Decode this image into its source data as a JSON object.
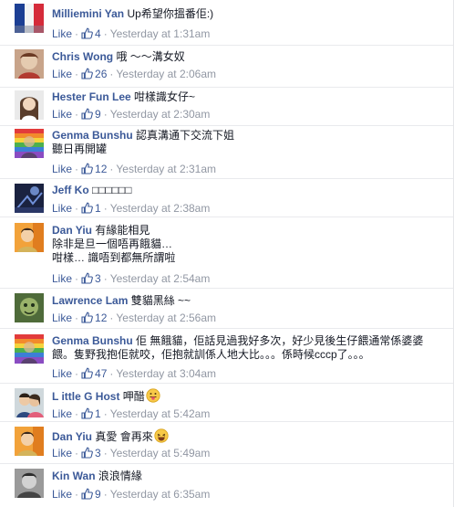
{
  "comments": [
    {
      "name": "Milliemini Yan",
      "lines": [
        "Up希望你搵番佢:)"
      ],
      "like": "Like",
      "likes": "4",
      "time": "Yesterday at 1:31am",
      "avatar": "flag"
    },
    {
      "name": "Chris Wong",
      "lines": [
        "哦 ～～溝女奴"
      ],
      "like": "Like",
      "likes": "26",
      "time": "Yesterday at 2:06am",
      "avatar": "red-portrait"
    },
    {
      "name": "Hester Fun Lee",
      "lines": [
        "咁樣識女仔~"
      ],
      "like": "Like",
      "likes": "9",
      "time": "Yesterday at 2:30am",
      "avatar": "woman-portrait"
    },
    {
      "name": "Genma Bunshu",
      "lines": [
        "認真溝通下交流下姐",
        "聽日再開罐"
      ],
      "like": "Like",
      "likes": "12",
      "time": "Yesterday at 2:31am",
      "avatar": "rainbow"
    },
    {
      "name": "Jeff Ko",
      "lines": [
        "□□□□□□"
      ],
      "like": "Like",
      "likes": "1",
      "time": "Yesterday at 2:38am",
      "avatar": "dark-blue"
    },
    {
      "name": "Dan Yiu",
      "lines": [
        "有緣能相見",
        "除非是旦一個唔再餓貓…",
        "咁樣… 識唔到都無所謂啦"
      ],
      "like": "Like",
      "likes": "3",
      "time": "Yesterday at 2:54am",
      "avatar": "orange-portrait"
    },
    {
      "name": "Lawrence Lam",
      "lines": [
        "雙貓黑絲 ~~"
      ],
      "like": "Like",
      "likes": "12",
      "time": "Yesterday at 2:56am",
      "avatar": "green-face"
    },
    {
      "name": "Genma Bunshu",
      "lines": [
        "佢 無餓貓，佢話見過我好多次，好少見後生仔餵通常係婆婆",
        "餵。隻野我抱佢就咬，佢抱就訓係人地大比。。。係時候cccp了。。。"
      ],
      "like": "Like",
      "likes": "47",
      "time": "Yesterday at 3:04am",
      "avatar": "rainbow"
    },
    {
      "name": "L ittle G Host",
      "lines": [
        "呷醋"
      ],
      "like": "Like",
      "likes": "1",
      "time": "Yesterday at 5:42am",
      "avatar": "couple",
      "emoji": "tongue-emoji"
    },
    {
      "name": "Dan Yiu",
      "lines": [
        "真愛 會再來"
      ],
      "like": "Like",
      "likes": "3",
      "time": "Yesterday at 5:49am",
      "avatar": "orange-portrait",
      "emoji": "laugh-emoji"
    },
    {
      "name": "Kin Wan",
      "lines": [
        "浪浪情緣"
      ],
      "like": "Like",
      "likes": "9",
      "time": "Yesterday at 6:35am",
      "avatar": "grey-portrait"
    }
  ],
  "separator": "·"
}
